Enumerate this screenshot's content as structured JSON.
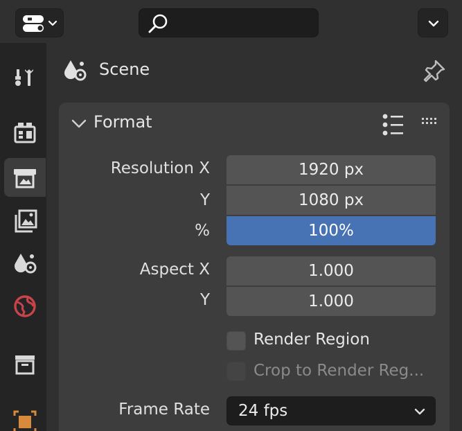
{
  "header": {
    "editor_type_icon": "editor-type-icon",
    "search_icon": "search-icon",
    "search_value": "",
    "options_icon": "chevron-down-icon"
  },
  "tabs": [
    {
      "name": "tool",
      "icon": "tool-icon"
    },
    {
      "name": "render",
      "icon": "render-icon"
    },
    {
      "name": "output",
      "icon": "output-icon",
      "active": true
    },
    {
      "name": "view-layer",
      "icon": "view-layer-icon"
    },
    {
      "name": "scene",
      "icon": "scene-icon"
    },
    {
      "name": "world",
      "icon": "world-icon"
    },
    {
      "name": "collection",
      "icon": "collection-icon"
    },
    {
      "name": "object",
      "icon": "object-icon"
    }
  ],
  "context": {
    "label": "Scene",
    "icon": "scene-icon",
    "pin_icon": "pin-icon"
  },
  "panel": {
    "title": "Format",
    "presets_icon": "presets-list-icon",
    "drag_icon": "drag-handle-icon"
  },
  "resolution": {
    "label_x": "Resolution X",
    "label_y": "Y",
    "label_percent": "%",
    "x_value": "1920 px",
    "y_value": "1080 px",
    "percent_value": "100%"
  },
  "aspect": {
    "label_x": "Aspect X",
    "label_y": "Y",
    "x_value": "1.000",
    "y_value": "1.000"
  },
  "render_region": {
    "label": "Render Region",
    "checked": false
  },
  "crop_region": {
    "label": "Crop to Render Reg...",
    "checked": false,
    "enabled": false
  },
  "frame_rate": {
    "label": "Frame Rate",
    "value": "24 fps"
  },
  "colors": {
    "accent": "#4772b3",
    "panel_bg": "#3d3d3d",
    "field_bg": "#545454",
    "world_icon": "#c9434b",
    "object_icon": "#d88a3c"
  }
}
